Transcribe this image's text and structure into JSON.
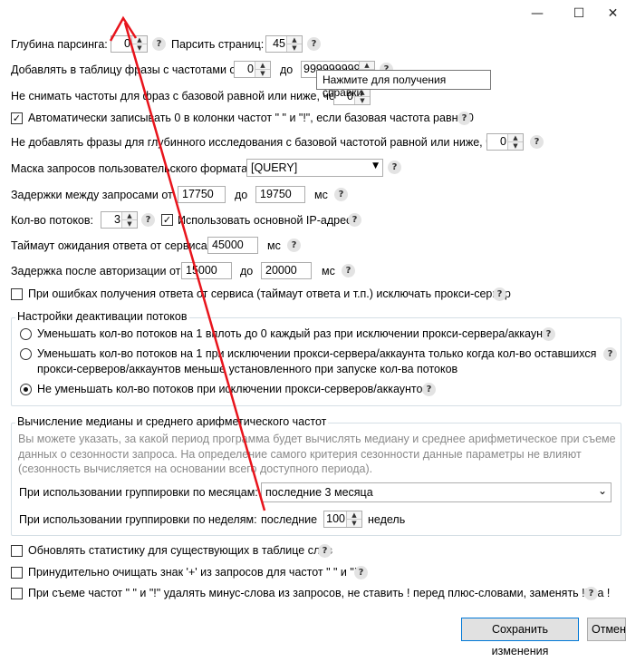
{
  "window": {
    "minimize_icon": "—",
    "maximize_icon": "☐",
    "close_icon": "✕"
  },
  "tooltip": "Нажмите для получения справки",
  "help_glyph": "?",
  "row_depth": {
    "label": "Глубина парсинга:",
    "value": "0",
    "pages_label": "Парсить страниц:",
    "pages_value": "45"
  },
  "row_freq": {
    "label": "Добавлять в таблицу фразы с частотами от",
    "from": "0",
    "to_label": "до",
    "to": "999999999"
  },
  "row_nokeep": {
    "label": "Не снимать частоты для фраз с базовой равной или ниже, чем",
    "value": "0"
  },
  "row_autozero": {
    "label": "Автоматически записывать 0 в колонки частот \" \" и \"!\", если базовая частота равна 0",
    "checked": "✓"
  },
  "row_deep": {
    "label": "Не добавлять фразы для глубинного исследования с базовой частотой равной или ниже, чем",
    "value": "0"
  },
  "row_mask": {
    "label": "Маска запросов пользовательского формата:",
    "value": "[QUERY]",
    "arrow": "▼"
  },
  "row_delay": {
    "label": "Задержки между запросами от",
    "from": "17750",
    "to_label": "до",
    "to": "19750",
    "unit": "мс"
  },
  "row_threads": {
    "label": "Кол-во потоков:",
    "value": "3",
    "ip_label": "Использовать основной IP-адрес",
    "ip_checked": "✓"
  },
  "row_timeout": {
    "label": "Таймаут ожидания ответа от сервиса:",
    "value": "45000",
    "unit": "мс"
  },
  "row_authdelay": {
    "label": "Задержка после авторизации от",
    "from": "15000",
    "to_label": "до",
    "to": "20000",
    "unit": "мс"
  },
  "row_exclude": {
    "label": "При ошибках получения ответа от сервиса (таймаут ответа и т.п.) исключать прокси-сервер"
  },
  "deactivation": {
    "title": "Настройки деактивации потоков",
    "opt1": "Уменьшать кол-во потоков на 1 вплоть до 0 каждый раз при исключении прокси-сервера/аккаунта",
    "opt2_line1": "Уменьшать кол-во потоков на 1 при исключении прокси-сервера/аккаунта только когда кол-во оставшихся",
    "opt2_line2": "прокси-серверов/аккаунтов меньше установленного при запуске кол-ва потоков",
    "opt3": "Не уменьшать кол-во потоков при исключении прокси-серверов/аккаунтов"
  },
  "median": {
    "title": "Вычисление медианы и среднего арифметического частот",
    "desc1": "Вы можете указать, за какой период программа будет вычислять медиану и среднее арифметическое при съеме",
    "desc2": "данных о сезонности запроса. На определение самого критерия сезонности данные параметры не влияют",
    "desc3": "(сезонность вычисляется на основании всего доступного периода).",
    "months_label": "При использовании группировки по месяцам:",
    "months_value": "последние 3 месяца",
    "months_arrow": "⌄",
    "weeks_label": "При использовании группировки по неделям:",
    "weeks_prefix": "последние",
    "weeks_value": "100",
    "weeks_suffix": "недель"
  },
  "row_update": {
    "label": "Обновлять статистику для существующих в таблице слов"
  },
  "row_plus": {
    "label": "Принудительно очищать знак '+' из запросов для частот \" \" и \"!\""
  },
  "row_minus": {
    "label": "При съеме частот \" \" и \"!\" удалять минус-слова из запросов, не ставить ! перед плюс-словами, заменять !! на !"
  },
  "buttons": {
    "save": "Сохранить изменения",
    "cancel": "Отмена"
  },
  "colors": {
    "annotation_arrow": "#e8141c",
    "focus_border": "#0078d7"
  }
}
